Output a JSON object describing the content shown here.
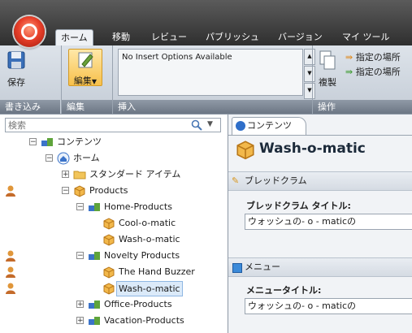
{
  "ribbon": {
    "tabs": [
      "ホーム",
      "移動",
      "レビュー",
      "パブリッシュ",
      "バージョン",
      "マイ ツール"
    ],
    "active_tab": "ホーム",
    "save_label": "保存",
    "edit_label": "編集",
    "insert_options_text": "No Insert Options Available",
    "copy_label": "複製",
    "move_to_1": "指定の場所",
    "move_to_2": "指定の場所",
    "groups": {
      "write": "書き込み",
      "edit": "編集",
      "insert": "挿入",
      "operations": "操作"
    }
  },
  "search": {
    "placeholder": "検索"
  },
  "tree": {
    "root": "コンテンツ",
    "home": "ホーム",
    "standard": "スタンダード アイテム",
    "products": "Products",
    "home_products": "Home-Products",
    "cool": "Cool-o-matic",
    "wash1": "Wash-o-matic",
    "novelty": "Novelty Products",
    "buzzer": "The Hand Buzzer",
    "wash2": "Wash-o-matic",
    "office": "Office-Products",
    "vacation": "Vacation-Products"
  },
  "content": {
    "tab_label": "コンテンツ",
    "item_title": "Wash-o-matic",
    "breadcrumb_section": "ブレッドクラム",
    "breadcrumb_field_label": "ブレッドクラム タイトル:",
    "breadcrumb_field_value": "ウォッシュの- o - maticの",
    "menu_section": "メニュー",
    "menu_field_label": "メニュータイトル:",
    "menu_field_value": "ウォッシュの- o - maticの"
  },
  "colors": {
    "ribbon_dark": "#3c3c3c",
    "ribbon_footer": "#7a8492",
    "selection": "#dbeaf9",
    "folder_yellow": "#f2b84b"
  }
}
